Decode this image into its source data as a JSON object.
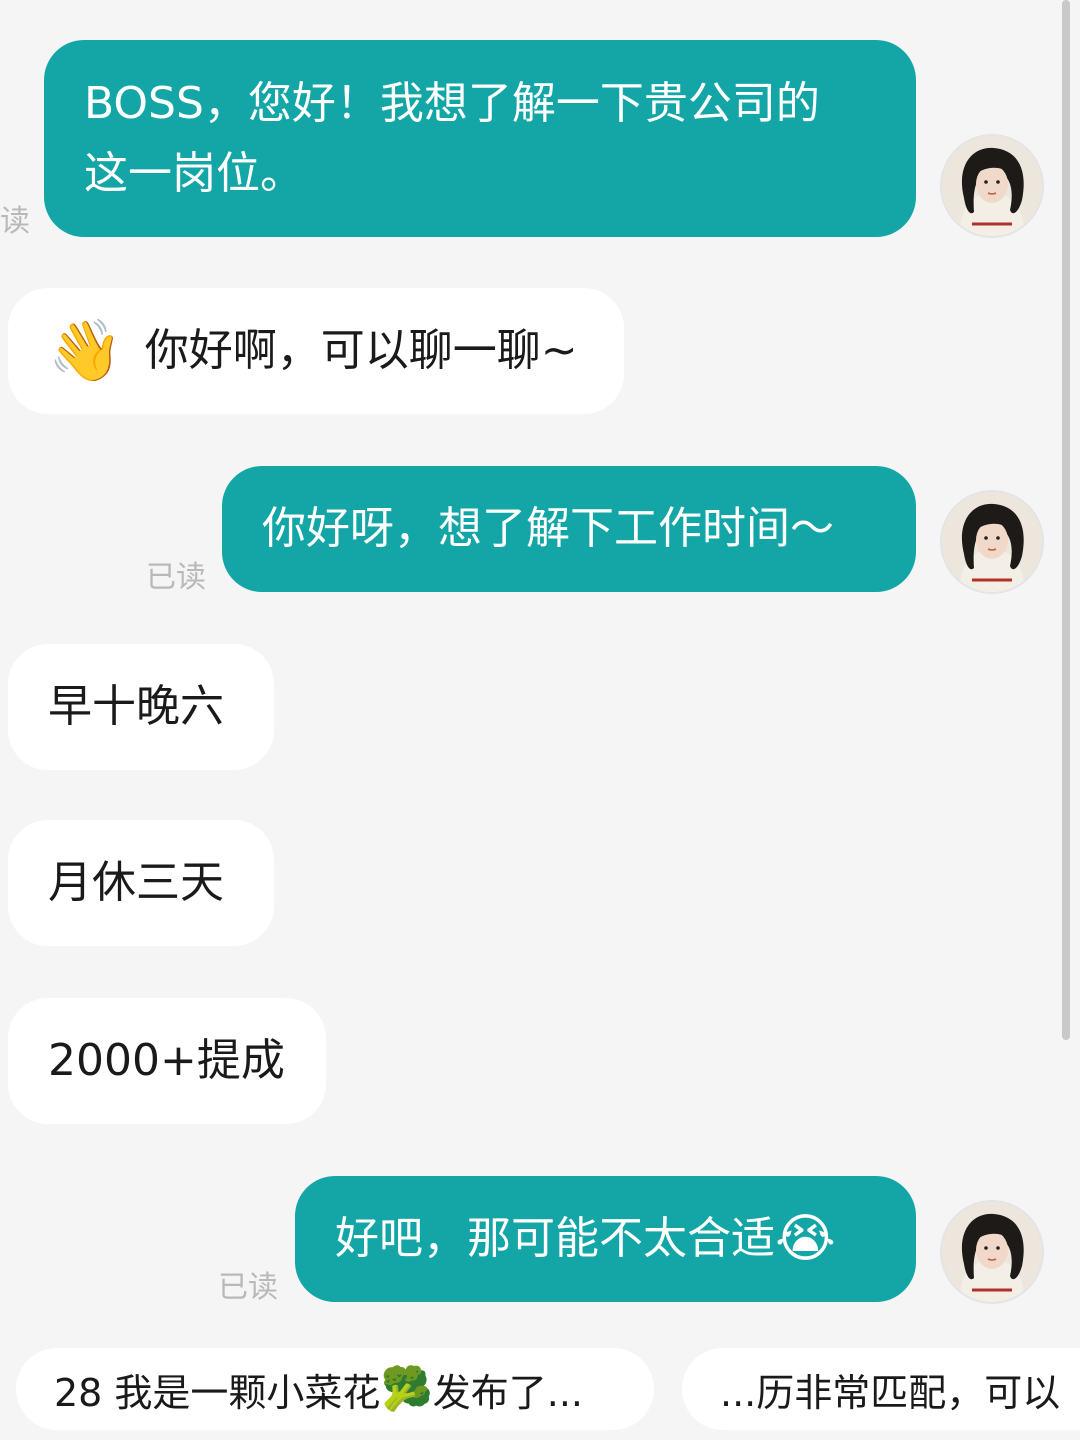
{
  "messages": [
    {
      "id": "m1",
      "direction": "out",
      "lines": [
        "BOSS，您好！我想了解一下贵公司的",
        "这一岗位。"
      ],
      "read_label": "读"
    },
    {
      "id": "m2",
      "direction": "in",
      "emoji": "👋",
      "text": "你好啊，可以聊一聊~"
    },
    {
      "id": "m3",
      "direction": "out",
      "text": "你好呀，想了解下工作时间～",
      "read_label": "已读"
    },
    {
      "id": "m4",
      "direction": "in",
      "text": "早十晚六"
    },
    {
      "id": "m5",
      "direction": "in",
      "text": "月休三天"
    },
    {
      "id": "m6",
      "direction": "in",
      "text": "2000+提成"
    },
    {
      "id": "m7",
      "direction": "out",
      "text": "好吧，那可能不太合适",
      "emoji": "😭",
      "read_label": "已读"
    }
  ],
  "suggestions": [
    {
      "prefix": "28 我是一颗小菜花",
      "emoji": "🥦",
      "suffix": "发布了..."
    },
    {
      "text": "...历非常匹配，可以"
    }
  ],
  "colors": {
    "outgoing_bubble": "#14a5a6",
    "incoming_bubble": "#ffffff",
    "background": "#f5f5f5",
    "read_label": "#b9b9b9"
  },
  "icons": {
    "avatar": "user-avatar-icon",
    "wave": "waving-hand-emoji",
    "cry": "loudly-crying-face-emoji",
    "broccoli": "broccoli-emoji"
  }
}
